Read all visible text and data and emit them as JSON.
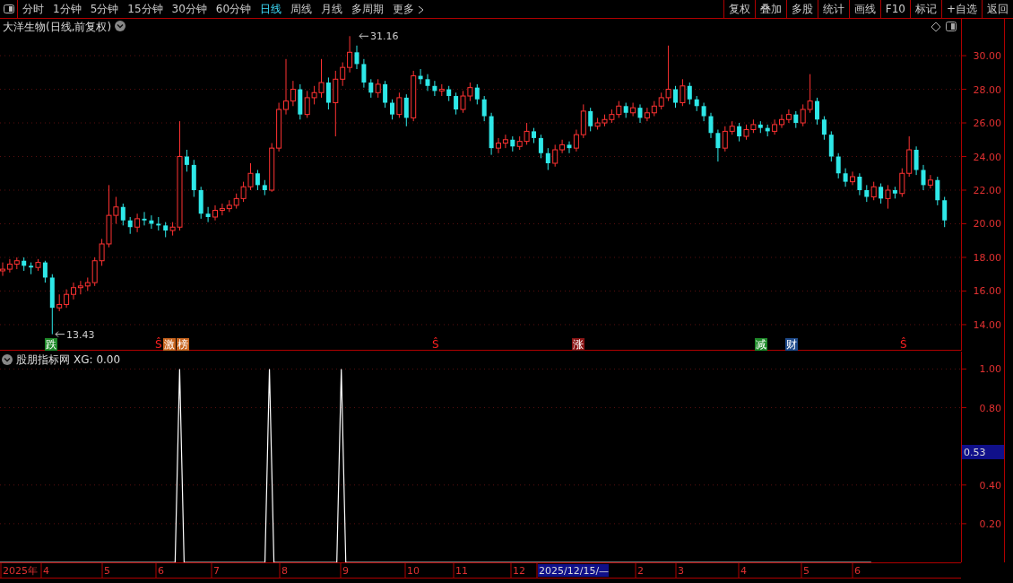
{
  "toolbar": {
    "periods": [
      {
        "label": "分时",
        "selected": false
      },
      {
        "label": "1分钟",
        "selected": false
      },
      {
        "label": "5分钟",
        "selected": false
      },
      {
        "label": "15分钟",
        "selected": false
      },
      {
        "label": "30分钟",
        "selected": false
      },
      {
        "label": "60分钟",
        "selected": false
      },
      {
        "label": "日线",
        "selected": true
      },
      {
        "label": "周线",
        "selected": false
      },
      {
        "label": "月线",
        "selected": false
      },
      {
        "label": "多周期",
        "selected": false
      },
      {
        "label": "更多",
        "selected": false
      }
    ],
    "actions": [
      "复权",
      "叠加",
      "多股",
      "统计",
      "画线",
      "F10",
      "标记",
      "+自选",
      "返回"
    ]
  },
  "main_chart": {
    "title": "大洋生物(日线,前复权)",
    "high_label": "31.16",
    "low_label": "13.43",
    "signals": [
      {
        "text": "跌",
        "color": "#1f8a2a"
      },
      {
        "text": "Ŝ",
        "color": "#ff2020"
      },
      {
        "text": "激",
        "color": "#c8641e"
      },
      {
        "text": "榜",
        "color": "#c8641e"
      },
      {
        "text": "Ŝ",
        "color": "#ff2020"
      },
      {
        "text": "涨",
        "color": "#8a1616"
      },
      {
        "text": "减",
        "color": "#1f8a2a"
      },
      {
        "text": "财",
        "color": "#1e4a8a"
      },
      {
        "text": "Ŝ",
        "color": "#ff2020"
      }
    ],
    "chart_data": {
      "type": "candlestick",
      "grid": true,
      "ylim": [
        12.45,
        32.19
      ],
      "yticks": [
        {
          "value": 30,
          "label": "30.00"
        },
        {
          "value": 28,
          "label": "28.00"
        },
        {
          "value": 26,
          "label": "26.00"
        },
        {
          "value": 24,
          "label": "24.00"
        },
        {
          "value": 22,
          "label": "22.00"
        },
        {
          "value": 20,
          "label": "20.00"
        },
        {
          "value": 18,
          "label": "18.00"
        },
        {
          "value": 16,
          "label": "16.00"
        },
        {
          "value": 14,
          "label": "14.00"
        }
      ],
      "ohlc": [
        [
          17.2,
          17.7,
          16.9,
          17.3
        ],
        [
          17.3,
          17.9,
          17.1,
          17.6
        ],
        [
          17.6,
          18.0,
          17.3,
          17.8
        ],
        [
          17.8,
          18.0,
          17.2,
          17.5
        ],
        [
          17.5,
          17.7,
          17.0,
          17.4
        ],
        [
          17.4,
          17.9,
          17.2,
          17.7
        ],
        [
          17.7,
          17.8,
          16.5,
          16.8
        ],
        [
          16.8,
          17.0,
          13.43,
          15.0
        ],
        [
          15.0,
          15.8,
          14.8,
          15.2
        ],
        [
          15.2,
          16.1,
          15.0,
          15.8
        ],
        [
          15.8,
          16.5,
          15.5,
          16.2
        ],
        [
          16.2,
          16.6,
          15.8,
          16.3
        ],
        [
          16.3,
          16.8,
          16.0,
          16.5
        ],
        [
          16.5,
          18.0,
          16.3,
          17.8
        ],
        [
          17.8,
          19.1,
          17.5,
          18.8
        ],
        [
          18.8,
          22.3,
          18.6,
          20.5
        ],
        [
          20.5,
          21.6,
          20.0,
          21.0
        ],
        [
          21.0,
          21.2,
          19.9,
          20.2
        ],
        [
          20.2,
          20.4,
          19.4,
          19.8
        ],
        [
          19.8,
          20.6,
          19.5,
          20.3
        ],
        [
          20.3,
          20.7,
          19.9,
          20.2
        ],
        [
          20.2,
          20.5,
          19.7,
          20.0
        ],
        [
          20.0,
          20.4,
          19.6,
          19.9
        ],
        [
          19.9,
          20.1,
          19.2,
          19.6
        ],
        [
          19.6,
          20.1,
          19.3,
          19.8
        ],
        [
          19.8,
          26.1,
          19.6,
          24.0
        ],
        [
          24.0,
          24.4,
          23.1,
          23.5
        ],
        [
          23.5,
          23.8,
          21.6,
          22.0
        ],
        [
          22.0,
          22.2,
          20.3,
          20.6
        ],
        [
          20.6,
          21.0,
          20.1,
          20.4
        ],
        [
          20.4,
          21.1,
          20.2,
          20.8
        ],
        [
          20.8,
          21.2,
          20.5,
          20.9
        ],
        [
          20.9,
          21.4,
          20.7,
          21.1
        ],
        [
          21.1,
          21.8,
          20.9,
          21.5
        ],
        [
          21.5,
          22.5,
          21.3,
          22.2
        ],
        [
          22.2,
          23.6,
          22.0,
          23.0
        ],
        [
          23.0,
          23.2,
          22.0,
          22.3
        ],
        [
          22.3,
          22.6,
          21.7,
          22.0
        ],
        [
          22.0,
          24.8,
          21.9,
          24.5
        ],
        [
          24.5,
          27.2,
          24.3,
          26.8
        ],
        [
          26.8,
          29.8,
          26.5,
          27.3
        ],
        [
          27.3,
          28.5,
          27.0,
          28.0
        ],
        [
          28.0,
          28.3,
          26.2,
          26.5
        ],
        [
          26.5,
          27.9,
          26.3,
          27.5
        ],
        [
          27.5,
          28.2,
          27.1,
          27.8
        ],
        [
          27.8,
          29.8,
          27.5,
          28.4
        ],
        [
          28.4,
          28.7,
          26.8,
          27.2
        ],
        [
          27.2,
          29.1,
          25.2,
          28.6
        ],
        [
          28.6,
          29.6,
          28.2,
          29.3
        ],
        [
          29.3,
          31.16,
          29.0,
          30.2
        ],
        [
          30.2,
          30.6,
          29.2,
          29.5
        ],
        [
          29.5,
          29.8,
          28.1,
          28.4
        ],
        [
          28.4,
          28.6,
          27.5,
          27.8
        ],
        [
          27.8,
          28.6,
          27.5,
          28.3
        ],
        [
          28.3,
          28.5,
          26.9,
          27.2
        ],
        [
          27.2,
          27.4,
          26.2,
          26.5
        ],
        [
          26.5,
          27.8,
          26.3,
          27.5
        ],
        [
          27.5,
          27.7,
          25.8,
          26.3
        ],
        [
          26.3,
          29.1,
          26.1,
          28.8
        ],
        [
          28.8,
          29.2,
          28.3,
          28.6
        ],
        [
          28.6,
          28.9,
          27.9,
          28.2
        ],
        [
          28.2,
          28.5,
          27.6,
          27.9
        ],
        [
          27.9,
          28.3,
          27.6,
          28.0
        ],
        [
          28.0,
          28.2,
          27.3,
          27.6
        ],
        [
          27.6,
          27.8,
          26.5,
          26.8
        ],
        [
          26.8,
          27.9,
          26.6,
          27.6
        ],
        [
          27.6,
          28.4,
          27.3,
          28.1
        ],
        [
          28.1,
          28.3,
          27.1,
          27.4
        ],
        [
          27.4,
          27.6,
          26.1,
          26.4
        ],
        [
          26.4,
          26.6,
          24.1,
          24.5
        ],
        [
          24.5,
          25.1,
          24.2,
          24.8
        ],
        [
          24.8,
          25.3,
          24.5,
          25.0
        ],
        [
          25.0,
          25.2,
          24.3,
          24.6
        ],
        [
          24.6,
          25.2,
          24.4,
          24.9
        ],
        [
          24.9,
          26.0,
          24.7,
          25.5
        ],
        [
          25.5,
          25.7,
          24.8,
          25.1
        ],
        [
          25.1,
          25.3,
          23.9,
          24.2
        ],
        [
          24.2,
          24.5,
          23.2,
          23.6
        ],
        [
          23.6,
          24.7,
          23.4,
          24.4
        ],
        [
          24.4,
          25.0,
          24.2,
          24.7
        ],
        [
          24.7,
          24.9,
          24.2,
          24.5
        ],
        [
          24.5,
          25.6,
          24.3,
          25.3
        ],
        [
          25.3,
          27.1,
          25.1,
          26.7
        ],
        [
          26.7,
          26.9,
          25.5,
          25.8
        ],
        [
          25.8,
          26.3,
          25.6,
          26.0
        ],
        [
          26.0,
          26.5,
          25.8,
          26.2
        ],
        [
          26.2,
          26.8,
          26.0,
          26.5
        ],
        [
          26.5,
          27.3,
          26.3,
          27.0
        ],
        [
          27.0,
          27.2,
          26.3,
          26.6
        ],
        [
          26.6,
          27.2,
          26.4,
          26.9
        ],
        [
          26.9,
          27.1,
          26.0,
          26.3
        ],
        [
          26.3,
          26.9,
          26.1,
          26.6
        ],
        [
          26.6,
          27.3,
          26.4,
          27.0
        ],
        [
          27.0,
          27.8,
          26.8,
          27.5
        ],
        [
          27.5,
          30.6,
          27.3,
          28.0
        ],
        [
          28.0,
          28.2,
          26.9,
          27.2
        ],
        [
          27.2,
          28.6,
          27.0,
          28.2
        ],
        [
          28.2,
          28.4,
          27.1,
          27.4
        ],
        [
          27.4,
          27.6,
          26.7,
          27.0
        ],
        [
          27.0,
          27.2,
          26.1,
          26.4
        ],
        [
          26.4,
          26.6,
          25.1,
          25.4
        ],
        [
          25.4,
          25.6,
          23.7,
          24.5
        ],
        [
          24.5,
          25.8,
          24.3,
          25.5
        ],
        [
          25.5,
          26.1,
          25.3,
          25.8
        ],
        [
          25.8,
          26.0,
          24.9,
          25.2
        ],
        [
          25.2,
          25.9,
          25.0,
          25.6
        ],
        [
          25.6,
          26.2,
          25.4,
          25.9
        ],
        [
          25.9,
          26.1,
          25.4,
          25.7
        ],
        [
          25.7,
          25.9,
          25.2,
          25.5
        ],
        [
          25.5,
          26.2,
          25.3,
          25.9
        ],
        [
          25.9,
          26.5,
          25.7,
          26.2
        ],
        [
          26.2,
          26.8,
          26.0,
          26.5
        ],
        [
          26.5,
          26.7,
          25.7,
          26.0
        ],
        [
          26.0,
          27.1,
          25.8,
          26.8
        ],
        [
          26.8,
          28.9,
          26.6,
          27.3
        ],
        [
          27.3,
          27.5,
          25.9,
          26.2
        ],
        [
          26.2,
          26.4,
          25.0,
          25.3
        ],
        [
          25.3,
          25.5,
          23.7,
          24.0
        ],
        [
          24.0,
          24.2,
          22.7,
          23.0
        ],
        [
          23.0,
          23.3,
          22.2,
          22.5
        ],
        [
          22.5,
          23.1,
          22.3,
          22.8
        ],
        [
          22.8,
          23.0,
          21.7,
          22.0
        ],
        [
          22.0,
          22.3,
          21.3,
          21.6
        ],
        [
          21.6,
          22.5,
          21.4,
          22.2
        ],
        [
          22.2,
          22.4,
          21.2,
          21.5
        ],
        [
          21.5,
          22.3,
          20.9,
          22.0
        ],
        [
          22.0,
          22.2,
          21.5,
          21.8
        ],
        [
          21.8,
          23.3,
          21.6,
          23.0
        ],
        [
          23.0,
          25.2,
          22.8,
          24.4
        ],
        [
          24.4,
          24.6,
          22.9,
          23.2
        ],
        [
          23.2,
          23.5,
          22.0,
          22.3
        ],
        [
          22.3,
          22.9,
          22.1,
          22.6
        ],
        [
          22.6,
          22.8,
          21.1,
          21.4
        ],
        [
          21.4,
          21.6,
          19.8,
          20.2
        ]
      ]
    }
  },
  "indicator": {
    "title": "股朋指标网",
    "reading": "XG: 0.00",
    "cursor_value": "0.53",
    "chart_data": {
      "type": "line",
      "grid": true,
      "ylim": [
        0,
        1.09
      ],
      "yticks": [
        {
          "value": 0.2,
          "label": "0.20"
        },
        {
          "value": 0.4,
          "label": "0.40"
        },
        {
          "value": 0.8,
          "label": "0.80"
        },
        {
          "value": 1,
          "label": "1.00"
        }
      ],
      "series": [
        {
          "color": "#ffffff",
          "values": [
            0,
            0,
            0,
            0,
            0,
            0,
            0,
            0,
            0,
            0,
            0,
            0,
            0,
            0,
            0,
            0,
            0,
            0,
            0,
            0,
            0,
            0,
            0,
            0,
            0,
            0,
            0,
            0,
            0,
            0,
            0,
            0,
            0,
            0,
            0,
            0,
            0,
            0,
            0,
            0,
            1,
            0,
            0,
            0,
            0,
            0,
            0,
            0,
            0,
            0,
            0,
            0,
            0,
            0,
            0,
            0,
            0,
            0,
            0,
            0,
            1,
            0,
            0,
            0,
            0,
            0,
            0,
            0,
            0,
            0,
            0,
            0,
            0,
            0,
            0,
            0,
            1,
            0,
            0,
            0,
            0,
            0,
            0,
            0,
            0,
            0,
            0,
            0,
            0,
            0,
            0,
            0,
            0,
            0,
            0,
            0,
            0,
            0,
            0,
            0,
            0,
            0,
            0,
            0,
            0,
            0,
            0,
            0,
            0,
            0,
            0,
            0,
            0,
            0,
            0,
            0,
            0,
            0,
            0,
            0,
            0,
            0,
            0,
            0,
            0,
            0,
            0,
            0,
            0,
            0,
            0,
            0,
            0,
            0,
            0,
            0,
            0,
            0,
            0,
            0,
            0,
            0,
            0,
            0,
            0,
            0,
            0,
            0,
            0,
            0,
            0,
            0,
            0,
            0,
            0,
            0,
            0,
            0,
            0,
            0,
            0,
            0,
            0,
            0,
            0,
            0,
            0,
            0,
            0,
            0,
            0,
            0,
            0,
            0,
            0,
            0,
            0,
            0,
            0,
            0,
            0,
            0,
            0,
            0,
            0,
            0,
            0,
            0,
            0,
            0,
            0,
            0,
            0,
            0,
            0,
            null,
            null,
            null,
            null,
            null,
            null,
            null,
            null,
            null,
            null,
            null,
            null,
            null,
            null,
            null,
            null,
            null,
            null,
            null,
            null
          ]
        }
      ]
    }
  },
  "date_axis": [
    {
      "text": "2025年",
      "selected": false
    },
    {
      "text": "4",
      "selected": false
    },
    {
      "text": "5",
      "selected": false
    },
    {
      "text": "6",
      "selected": false
    },
    {
      "text": "7",
      "selected": false
    },
    {
      "text": "8",
      "selected": false
    },
    {
      "text": "9",
      "selected": false
    },
    {
      "text": "10",
      "selected": false
    },
    {
      "text": "11",
      "selected": false
    },
    {
      "text": "12",
      "selected": false
    },
    {
      "text": "2025/12/15/—",
      "selected": true
    },
    {
      "text": "2",
      "selected": false
    },
    {
      "text": "3",
      "selected": false
    },
    {
      "text": "4",
      "selected": false
    },
    {
      "text": "5",
      "selected": false
    },
    {
      "text": "6",
      "selected": false
    }
  ]
}
